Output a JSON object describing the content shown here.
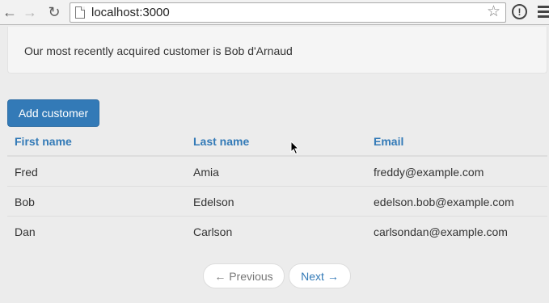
{
  "browser": {
    "url": "localhost:3000",
    "back_icon": "←",
    "forward_icon": "→",
    "reload_icon": "↻",
    "star_icon": "☆",
    "info_icon": "!"
  },
  "banner": {
    "text": "Our most recently acquired customer is Bob d'Arnaud"
  },
  "actions": {
    "add_customer": "Add customer"
  },
  "table": {
    "headers": [
      "First name",
      "Last name",
      "Email"
    ],
    "rows": [
      [
        "Fred",
        "Amia",
        "freddy@example.com"
      ],
      [
        "Bob",
        "Edelson",
        "edelson.bob@example.com"
      ],
      [
        "Dan",
        "Carlson",
        "carlsondan@example.com"
      ]
    ]
  },
  "pagination": {
    "previous": "← Previous",
    "next": "Next →"
  },
  "colors": {
    "primary": "#337ab7",
    "background": "#ececec",
    "well": "#f5f5f5"
  }
}
